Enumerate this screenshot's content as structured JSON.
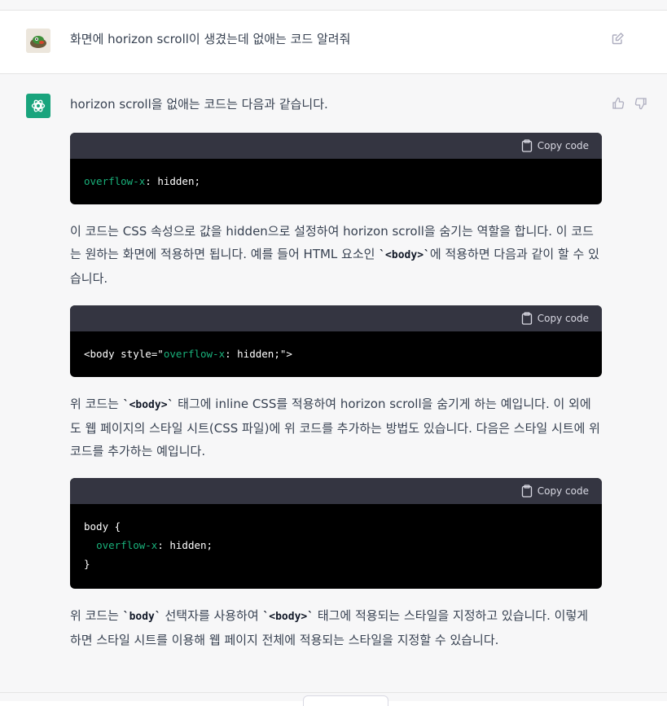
{
  "user": {
    "message": "화면에 horizon scroll이 생겼는데 없애는 코드 알려줘"
  },
  "assistant": {
    "p1": "horizon scroll을 없애는 코드는 다음과 같습니다.",
    "copy_label": "Copy code",
    "code1": {
      "prop": "overflow-x",
      "rest": ": hidden;"
    },
    "p2_a": "이 코드는 CSS 속성으로 값을 hidden으로 설정하여 horizon scroll을 숨기는 역할을 합니다. 이 코드는 원하는 화면에 적용하면 됩니다. 예를 들어 HTML 요소인 ",
    "p2_code": "`<body>`",
    "p2_b": "에 적용하면 다음과 같이 할 수 있습니다.",
    "code2": {
      "pre": "<body style=\"",
      "prop": "overflow-x",
      "rest": ": hidden;\">"
    },
    "p3_a": "위 코드는 ",
    "p3_code": "`<body>`",
    "p3_b": " 태그에 inline CSS를 적용하여 horizon scroll을 숨기게 하는 예입니다. 이 외에도 웹 페이지의 스타일 시트(CSS 파일)에 위 코드를 추가하는 방법도 있습니다. 다음은 스타일 시트에 위 코드를 추가하는 예입니다.",
    "code3": {
      "line1": "body {",
      "indent": "  ",
      "prop": "overflow-x",
      "rest": ": hidden;",
      "line3": "}"
    },
    "p4_a": "위 코드는 ",
    "p4_code1": "`body`",
    "p4_b": " 선택자를 사용하여 ",
    "p4_code2": "`<body>`",
    "p4_c": " 태그에 적용되는 스타일을 지정하고 있습니다. 이렇게 하면 스타일 시트를 이용해 웹 페이지 전체에 적용되는 스타일을 지정할 수 있습니다."
  },
  "icons": {
    "user_avatar": "avatar-icon",
    "assistant_avatar": "openai-logo-icon",
    "edit": "edit-icon",
    "thumbs_up": "thumbs-up-icon",
    "thumbs_down": "thumbs-down-icon",
    "clipboard": "clipboard-icon"
  },
  "colors": {
    "assistant_bg": "#f7f7f8",
    "accent_green": "#19a47d",
    "code_keyword": "#19b07a"
  }
}
